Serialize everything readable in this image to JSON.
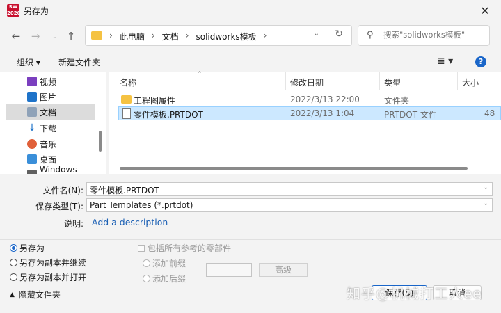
{
  "window": {
    "title": "另存为",
    "app_icon_text": "SW 2020"
  },
  "nav": {
    "back_icon": "arrow-left-icon",
    "forward_icon": "arrow-right-icon",
    "up_icon": "arrow-up-icon"
  },
  "address": {
    "crumbs": [
      "此电脑",
      "文档",
      "solidworks模板"
    ]
  },
  "search": {
    "placeholder": "搜索\"solidworks模板\""
  },
  "toolbar": {
    "organize_label": "组织 ▾",
    "new_folder_label": "新建文件夹",
    "view_label": "≣ ▾",
    "help_label": "?"
  },
  "sidebar": {
    "items": [
      {
        "label": "视频",
        "icon": "video-icon",
        "color": "#7b3fbf"
      },
      {
        "label": "图片",
        "icon": "picture-icon",
        "color": "#1e73c9"
      },
      {
        "label": "文档",
        "icon": "document-icon",
        "color": "#8fa2b8"
      },
      {
        "label": "下载",
        "icon": "download-icon",
        "color": "#1e73c9"
      },
      {
        "label": "音乐",
        "icon": "music-icon",
        "color": "#e0603a"
      },
      {
        "label": "桌面",
        "icon": "desktop-icon",
        "color": "#3a8fd9"
      },
      {
        "label": "Windows (C:)",
        "icon": "drive-icon",
        "color": "#606060"
      }
    ]
  },
  "files": {
    "columns": [
      "名称",
      "修改日期",
      "类型",
      "大小"
    ],
    "rows": [
      {
        "name": "工程图属性",
        "date": "2022/3/13 22:00",
        "type": "文件夹",
        "size": "",
        "icon": "folder-icon"
      },
      {
        "name": "零件模板.PRTDOT",
        "date": "2022/3/13 1:04",
        "type": "PRTDOT 文件",
        "size": "48",
        "icon": "file-icon"
      }
    ]
  },
  "form": {
    "filename_label": "文件名(N):",
    "filename_value": "零件模板.PRTDOT",
    "filetype_label": "保存类型(T):",
    "filetype_value": "Part Templates (*.prtdot)",
    "desc_label": "说明:",
    "desc_link": "Add a description"
  },
  "options": {
    "save_as": "另存为",
    "save_copy_continue": "另存为副本并继续",
    "save_copy_open": "另存为副本并打开",
    "include_refs": "包括所有参考的零部件",
    "add_prefix": "添加前缀",
    "add_suffix": "添加后缀",
    "advanced": "高级"
  },
  "footer": {
    "hide_folders": "隐藏文件夹",
    "save": "保存(S)",
    "cancel": "取消"
  },
  "watermark": "知乎@机械打工人ee"
}
